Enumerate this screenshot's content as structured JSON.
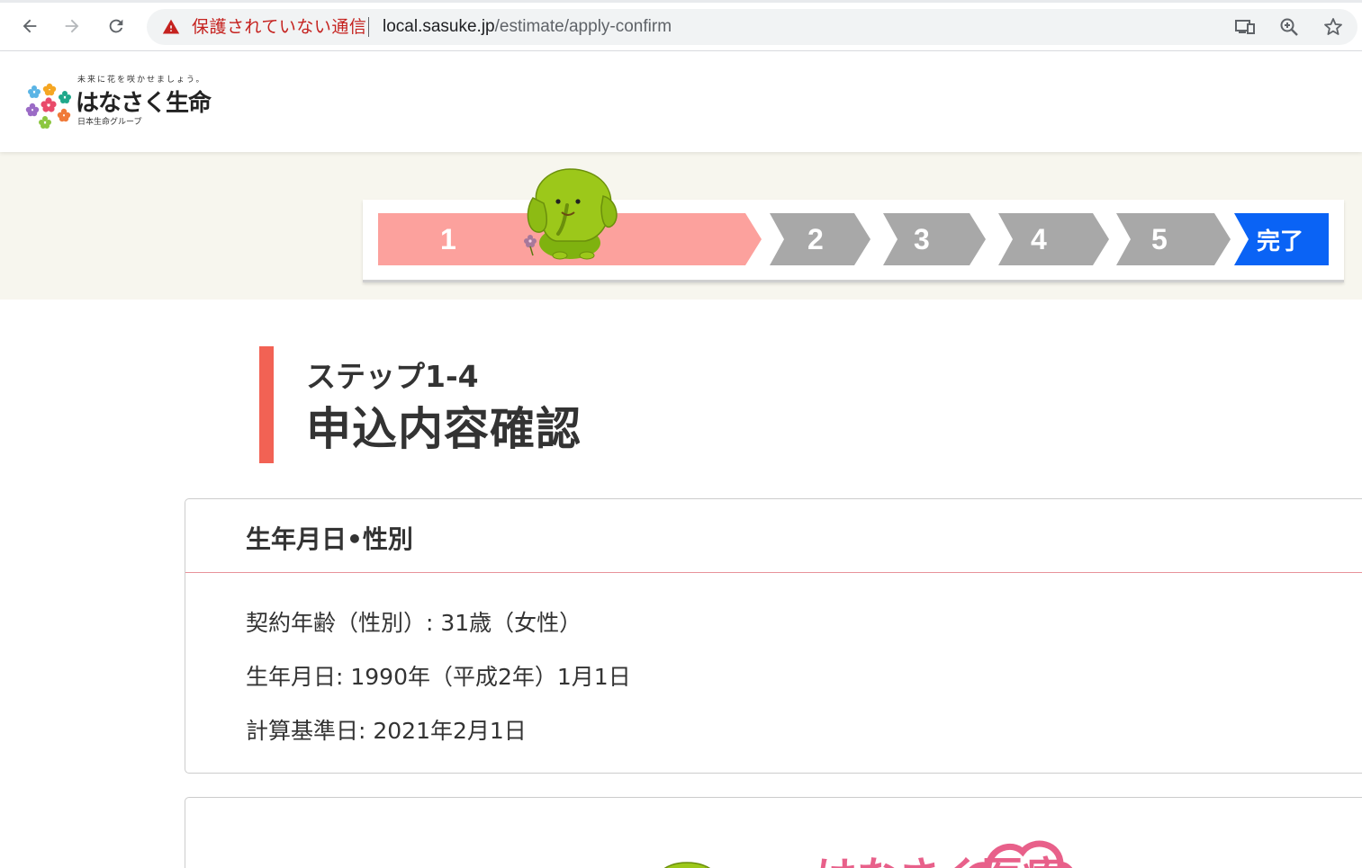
{
  "browser": {
    "insecure_label": "保護されていない通信",
    "url_host": "local.sasuke.jp",
    "url_path": "/estimate/apply-confirm",
    "icons": [
      "back-arrow-icon",
      "forward-arrow-icon",
      "reload-icon",
      "warning-triangle-icon",
      "cast-device-icon",
      "zoom-icon",
      "star-bookmark-icon"
    ],
    "colors": {
      "insecure": "#c5221f"
    }
  },
  "header": {
    "tagline": "未来に花を咲かせましょう。",
    "brand": "はなさく生命",
    "group": "日本生命グループ"
  },
  "progress": {
    "steps": [
      "1",
      "2",
      "3",
      "4",
      "5",
      "完了"
    ],
    "current_step": 1,
    "colors": {
      "current": "#fca19d",
      "pending": "#a8a8a8",
      "done": "#0a63f5"
    }
  },
  "step_heading": {
    "sub": "ステップ1-4",
    "title": "申込内容確認",
    "accent_color": "#f26254"
  },
  "birth_card": {
    "title": "生年月日•性別",
    "rows": [
      "契約年齢（性別）: 31歳（女性）",
      "生年月日: 1990年（平成2年）1月1日",
      "計算基準日: 2021年2月1日"
    ]
  },
  "banner": {
    "brand_text": "はなさく医療"
  }
}
